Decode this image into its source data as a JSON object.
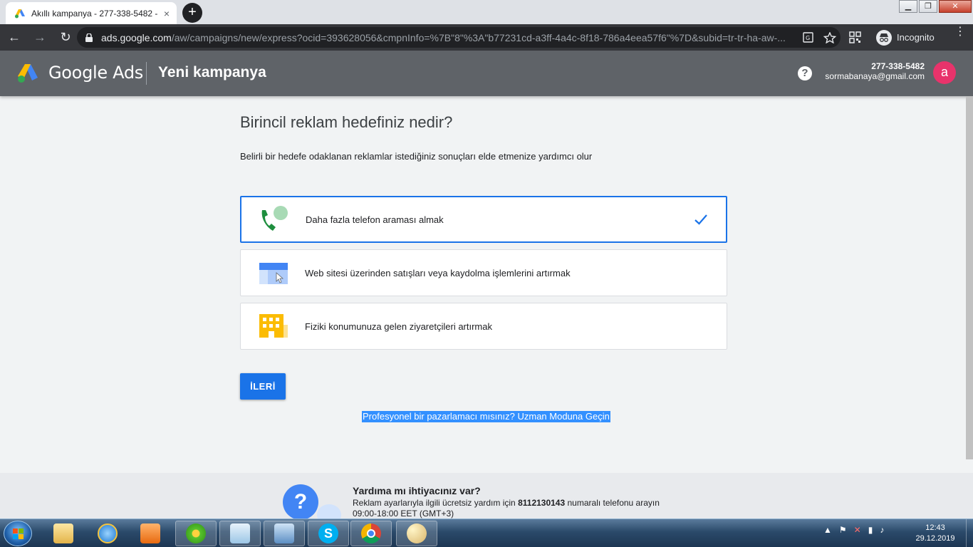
{
  "browser": {
    "tab_title": "Akıllı kampanya - 277-338-5482 -",
    "tab_close": "×",
    "new_tab": "+",
    "url_host": "ads.google.com",
    "url_path": "/aw/campaigns/new/express?ocid=393628056&cmpnInfo=%7B\"8\"%3A\"b77231cd-a3ff-4a4c-8f18-786a4eea57f6\"%7D&subid=tr-tr-ha-aw-...",
    "incognito_label": "Incognito",
    "back": "←",
    "forward": "→",
    "reload": "↻",
    "menu": "⋮",
    "window_minimize": "▁",
    "window_restore": "❐",
    "window_close": "✕"
  },
  "ads_header": {
    "brand": "Google Ads",
    "page_title": "Yeni kampanya",
    "help": "?",
    "account_id": "277-338-5482",
    "account_email": "sormabanaya@gmail.com",
    "avatar_letter": "a"
  },
  "main": {
    "question": "Birincil reklam hedefiniz nedir?",
    "subtitle": "Belirli bir hedefe odaklanan reklamlar istediğiniz sonuçları elde etmenize yardımcı olur",
    "options": [
      {
        "label": "Daha fazla telefon araması almak",
        "selected": true,
        "icon": "phone-call-icon"
      },
      {
        "label": "Web sitesi üzerinden satışları veya kaydolma işlemlerini artırmak",
        "selected": false,
        "icon": "website-click-icon"
      },
      {
        "label": "Fiziki konumunuza gelen ziyaretçileri artırmak",
        "selected": false,
        "icon": "store-building-icon"
      }
    ],
    "next_button": "İLERİ",
    "expert_link": "Profesyonel bir pazarlamacı mısınız? Uzman Moduna Geçin"
  },
  "help_footer": {
    "title": "Yardıma mı ihtiyacınız var?",
    "line1_prefix": "Reklam ayarlarıyla ilgili ücretsiz yardım için",
    "phone": "8112130143",
    "line1_suffix": "numaralı telefonu arayın",
    "hours": "09:00-18:00 EET (GMT+3)"
  },
  "taskbar": {
    "time": "12:43",
    "date": "29.12.2019",
    "apps": [
      "file-explorer-icon",
      "internet-explorer-icon",
      "media-player-icon",
      "icq-icon",
      "notepad-icon",
      "control-panel-icon",
      "skype-icon",
      "chrome-icon",
      "paint-icon"
    ]
  },
  "colors": {
    "accent_blue": "#1a73e8",
    "header_gray": "#5f6368",
    "avatar_pink": "#e8336b",
    "page_bg": "#f1f3f4"
  }
}
